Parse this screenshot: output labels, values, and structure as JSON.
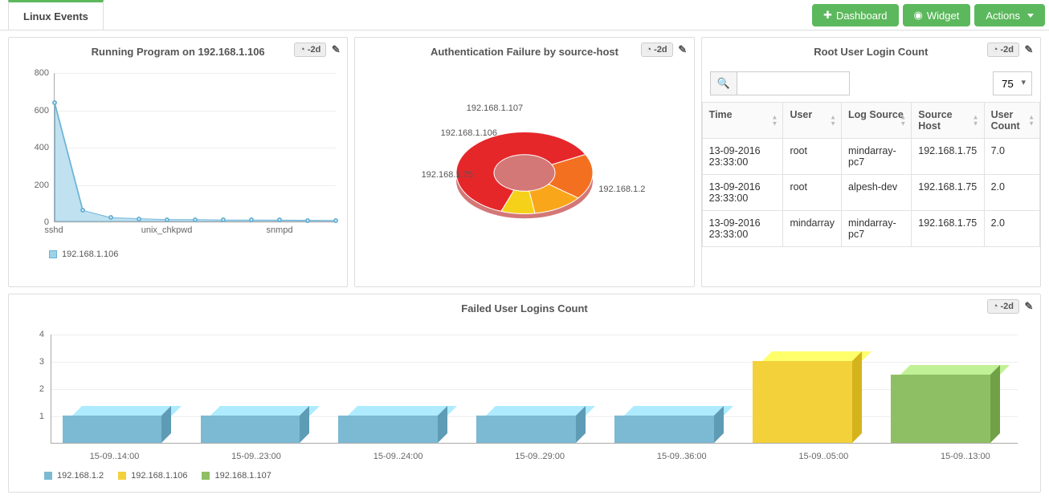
{
  "tabs": {
    "linux_events": "Linux Events"
  },
  "buttons": {
    "dashboard": "Dashboard",
    "widget": "Widget",
    "actions": "Actions"
  },
  "time_range_label": "-2d",
  "panels": {
    "running": {
      "title": "Running Program on 192.168.1.106",
      "legend_series": "192.168.1.106"
    },
    "authfail": {
      "title": "Authentication Failure by source-host"
    },
    "rootlogin": {
      "title": "Root User Login Count",
      "page_size": "75",
      "columns": {
        "time": "Time",
        "user": "User",
        "logsource": "Log Source",
        "sourcehost": "Source Host",
        "usercount": "User Count"
      },
      "rows": [
        {
          "time": "13-09-2016 23:33:00",
          "user": "root",
          "logsource": "mindarray-pc7",
          "sourcehost": "192.168.1.75",
          "usercount": "7.0"
        },
        {
          "time": "13-09-2016 23:33:00",
          "user": "root",
          "logsource": "alpesh-dev",
          "sourcehost": "192.168.1.75",
          "usercount": "2.0"
        },
        {
          "time": "13-09-2016 23:33:00",
          "user": "mindarray",
          "logsource": "mindarray-pc7",
          "sourcehost": "192.168.1.75",
          "usercount": "2.0"
        }
      ]
    },
    "failedlogins": {
      "title": "Failed User Logins Count",
      "legend": {
        "a": "192.168.1.2",
        "b": "192.168.1.106",
        "c": "192.168.1.107"
      }
    }
  },
  "chart_data": [
    {
      "id": "running_program",
      "type": "area",
      "title": "Running Program on 192.168.1.106",
      "ylim": [
        0,
        800
      ],
      "yticks": [
        0,
        200,
        400,
        600,
        800
      ],
      "categories": [
        "sshd",
        "",
        "",
        "",
        "unix_chkpwd",
        "",
        "",
        "",
        "snmpd",
        "",
        ""
      ],
      "series": [
        {
          "name": "192.168.1.106",
          "values": [
            640,
            60,
            20,
            15,
            10,
            10,
            8,
            8,
            7,
            6,
            5
          ]
        }
      ],
      "xlabel": "",
      "ylabel": ""
    },
    {
      "id": "auth_failure",
      "type": "pie",
      "title": "Authentication Failure by source-host",
      "slices": [
        {
          "label": "192.168.1.2",
          "value": 62,
          "color": "#e5272a"
        },
        {
          "label": "192.168.1.75",
          "value": 18,
          "color": "#f37021"
        },
        {
          "label": "192.168.1.106",
          "value": 12,
          "color": "#f9a61a"
        },
        {
          "label": "192.168.1.107",
          "value": 8,
          "color": "#f6d119"
        }
      ]
    },
    {
      "id": "failed_logins",
      "type": "bar",
      "title": "Failed User Logins Count",
      "ylim": [
        0,
        4
      ],
      "yticks": [
        1,
        2,
        3,
        4
      ],
      "categories": [
        "15-09..14:00",
        "15-09..23:00",
        "15-09..24:00",
        "15-09..29:00",
        "15-09..36:00",
        "15-09..05:00",
        "15-09..13:00"
      ],
      "series_colors": {
        "192.168.1.2": "#7cb9d3",
        "192.168.1.106": "#f3d13a",
        "192.168.1.107": "#8fbf64"
      },
      "bars": [
        {
          "category": "15-09..14:00",
          "series": "192.168.1.2",
          "value": 1
        },
        {
          "category": "15-09..23:00",
          "series": "192.168.1.2",
          "value": 1
        },
        {
          "category": "15-09..24:00",
          "series": "192.168.1.2",
          "value": 1
        },
        {
          "category": "15-09..29:00",
          "series": "192.168.1.2",
          "value": 1
        },
        {
          "category": "15-09..36:00",
          "series": "192.168.1.2",
          "value": 1
        },
        {
          "category": "15-09..05:00",
          "series": "192.168.1.106",
          "value": 3
        },
        {
          "category": "15-09..13:00",
          "series": "192.168.1.107",
          "value": 2.5
        }
      ]
    }
  ]
}
